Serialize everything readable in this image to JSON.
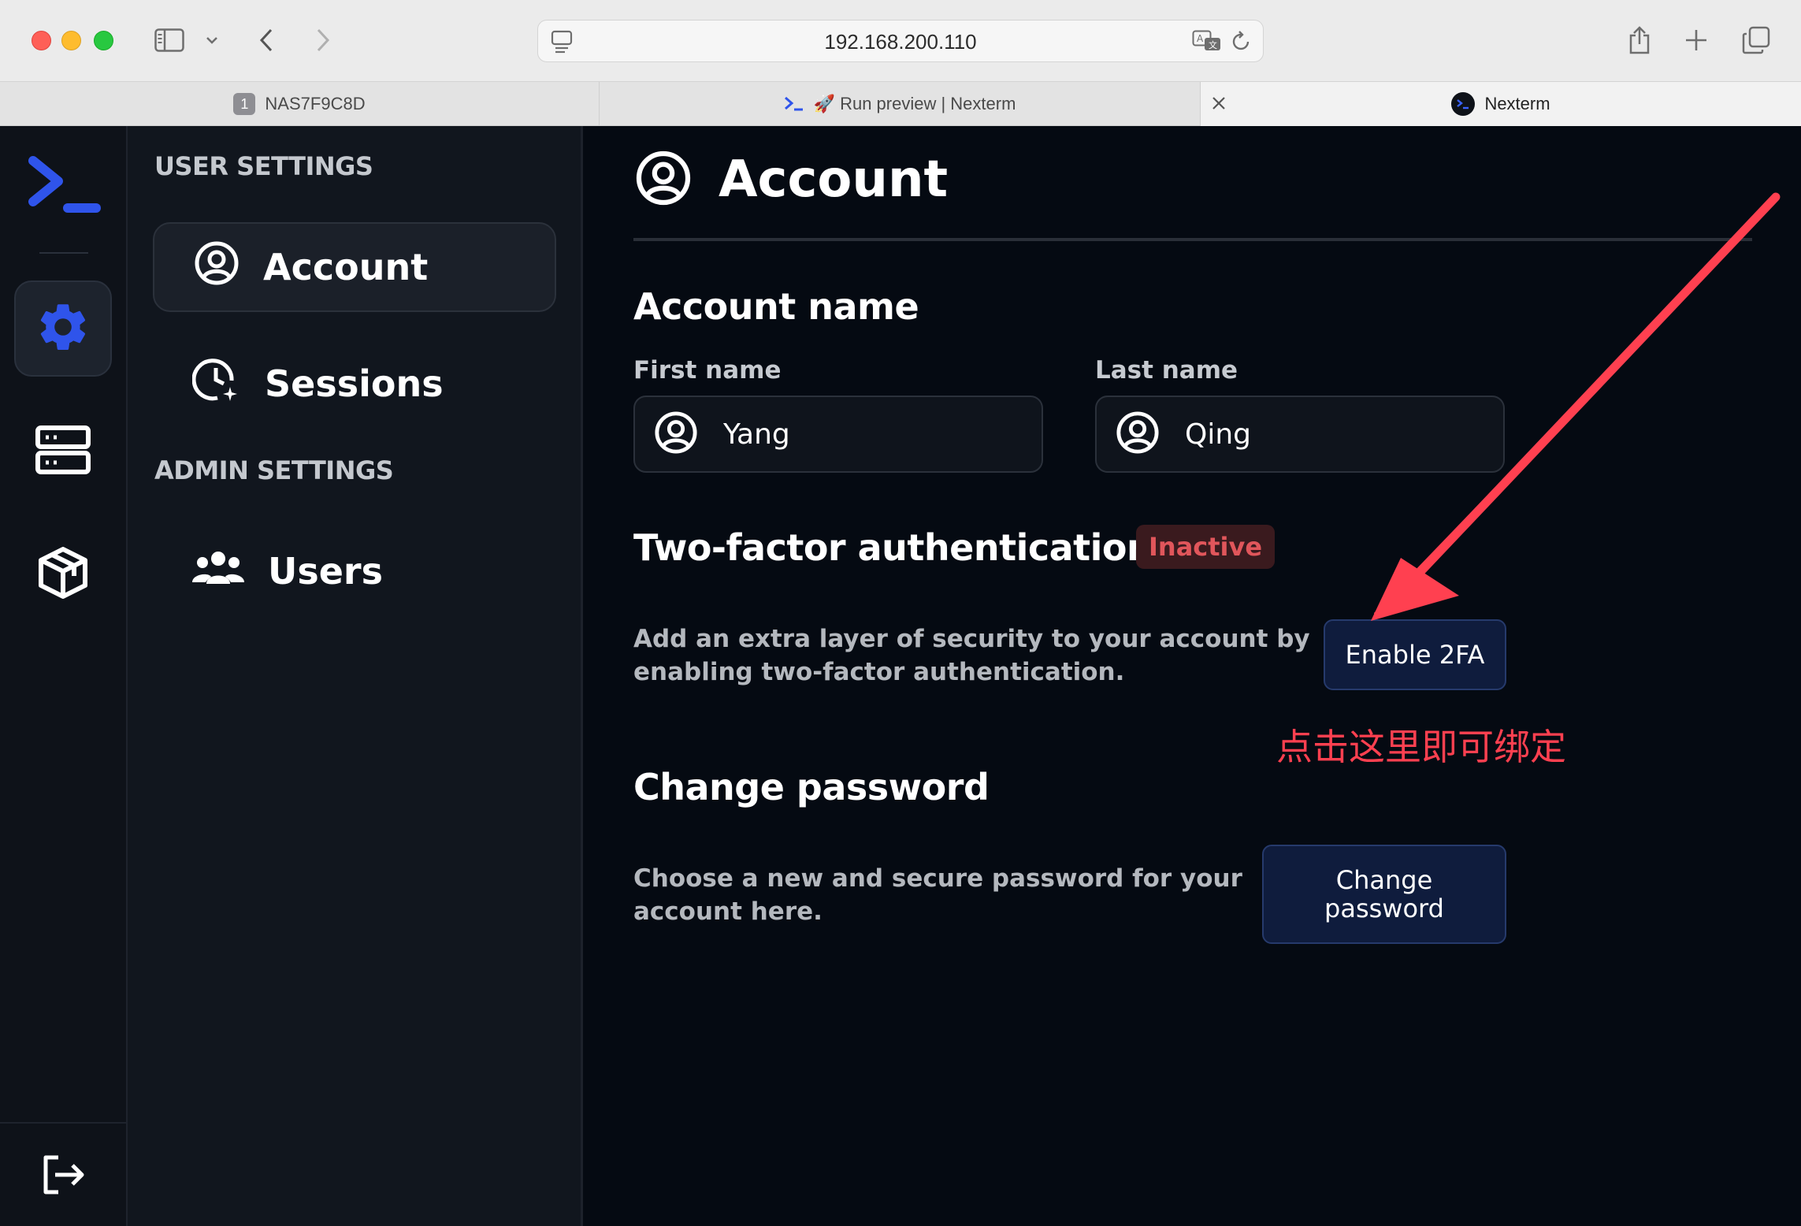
{
  "browser": {
    "address": "192.168.200.110",
    "tabs": [
      {
        "badge": "1",
        "label": "NAS7F9C8D"
      },
      {
        "label": "🚀 Run preview | Nexterm"
      },
      {
        "label": "Nexterm"
      }
    ]
  },
  "settings_nav": {
    "user_section": "USER SETTINGS",
    "admin_section": "ADMIN SETTINGS",
    "items": [
      {
        "label": "Account",
        "icon": "user-circle-icon"
      },
      {
        "label": "Sessions",
        "icon": "clock-sparkle-icon"
      },
      {
        "label": "Users",
        "icon": "users-icon"
      }
    ]
  },
  "rail": {
    "items": [
      "gear-icon",
      "servers-icon",
      "package-icon"
    ],
    "bottom": "logout-icon"
  },
  "account": {
    "title": "Account",
    "name_heading": "Account name",
    "first_name_label": "First name",
    "first_name_value": "Yang",
    "last_name_label": "Last name",
    "last_name_value": "Qing",
    "twofa_heading": "Two-factor authentication",
    "twofa_status": "Inactive",
    "twofa_desc_1": "Add an extra layer of security to your account by",
    "twofa_desc_2": "enabling two-factor authentication.",
    "twofa_button": "Enable 2FA",
    "annotation": "点击这里即可绑定",
    "password_heading": "Change password",
    "password_desc_1": "Choose a new and secure password for your",
    "password_desc_2": "account here.",
    "password_button_1": "Change",
    "password_button_2": "password"
  },
  "colors": {
    "accent": "#2f54eb",
    "danger": "#e0565b",
    "annotation": "#ff4050"
  }
}
